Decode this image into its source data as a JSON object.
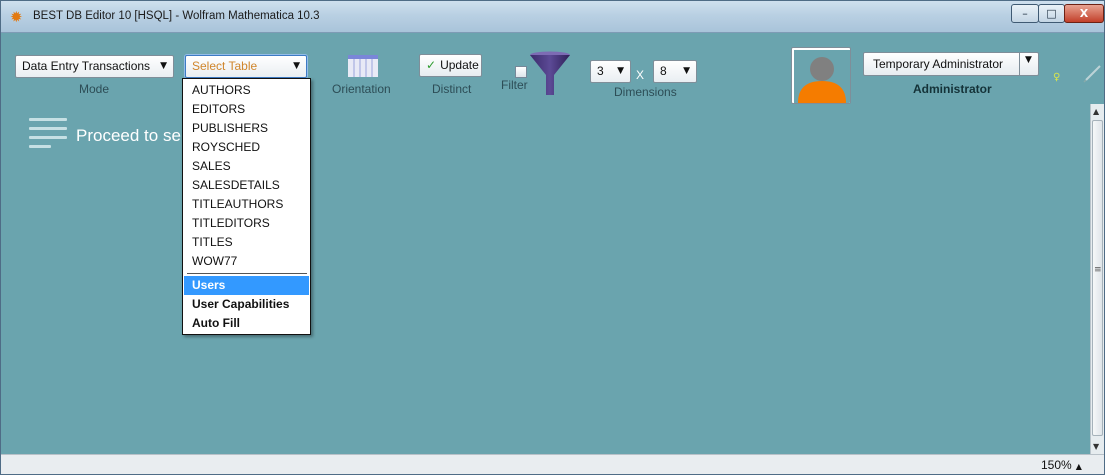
{
  "window": {
    "title": "BEST DB Editor 10 [HSQL] - Wolfram Mathematica 10.3",
    "app_icon": "sunburst-icon",
    "controls": {
      "minimize": "–",
      "maximize": "□",
      "close": "X"
    }
  },
  "toolbar": {
    "mode_value": "Data Entry Transactions",
    "mode_caption": "Mode",
    "table_value": "Select Table",
    "orientation_caption": "Orientation",
    "update_label": "Update",
    "update_icon": "checkmark-icon",
    "distinct_caption": "Distinct",
    "filter_caption": "Filter",
    "filter_checked": false,
    "rows_value": "3",
    "x_label": "X",
    "cols_value": "8",
    "dimensions_caption": "Dimensions",
    "user_name": "Temporary Administrator",
    "user_role": "Administrator"
  },
  "table_options": {
    "items": [
      "AUTHORS",
      "EDITORS",
      "PUBLISHERS",
      "ROYSCHED",
      "SALES",
      "SALESDETAILS",
      "TITLEAUTHORS",
      "TITLEDITORS",
      "TITLES",
      "WOW77"
    ],
    "admin_items": [
      "Users",
      "User Capabilities",
      "Auto Fill"
    ],
    "selected": "Users"
  },
  "content": {
    "prompt": "Proceed to se"
  },
  "status": {
    "zoom": "150%"
  },
  "colors": {
    "background": "#6aa4ae",
    "selection": "#3399ff",
    "placeholder": "#d0862c",
    "avatar_body": "#f57c00",
    "avatar_head": "#808080"
  }
}
